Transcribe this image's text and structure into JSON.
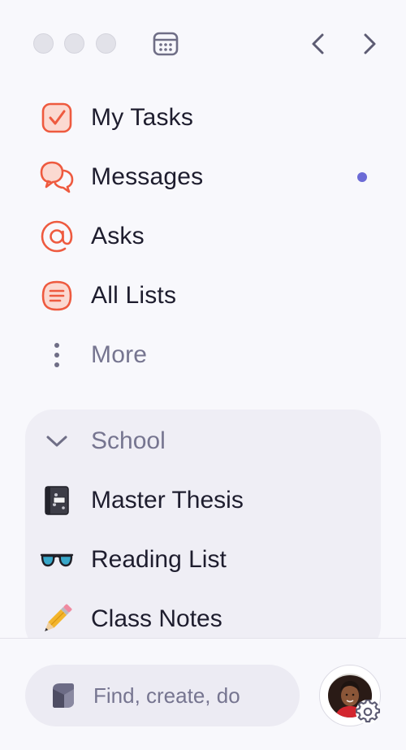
{
  "titlebar": {
    "window_controls": [
      "close",
      "minimize",
      "zoom"
    ],
    "calendar_icon": "calendar-icon",
    "back_icon": "chevron-left-icon",
    "forward_icon": "chevron-right-icon"
  },
  "nav": {
    "items": [
      {
        "label": "My Tasks",
        "icon": "checkbox-icon",
        "unread": false
      },
      {
        "label": "Messages",
        "icon": "chat-bubbles-icon",
        "unread": true
      },
      {
        "label": "Asks",
        "icon": "at-sign-icon",
        "unread": false
      },
      {
        "label": "All Lists",
        "icon": "list-icon",
        "unread": false
      },
      {
        "label": "More",
        "icon": "more-vertical-icon",
        "unread": false
      }
    ]
  },
  "group": {
    "title": "School",
    "expanded": true,
    "items": [
      {
        "label": "Master Thesis",
        "emoji": "📓"
      },
      {
        "label": "Reading List",
        "emoji": "👓"
      },
      {
        "label": "Class Notes",
        "emoji": "✏️"
      }
    ]
  },
  "footer": {
    "search_placeholder": "Find, create, do",
    "avatar_icon": "user-avatar",
    "settings_icon": "gear-icon"
  },
  "colors": {
    "accent": "#ee5a3f",
    "unread_dot": "#6c6bd6",
    "background": "#f8f8fc",
    "group_background": "#efeef5"
  }
}
